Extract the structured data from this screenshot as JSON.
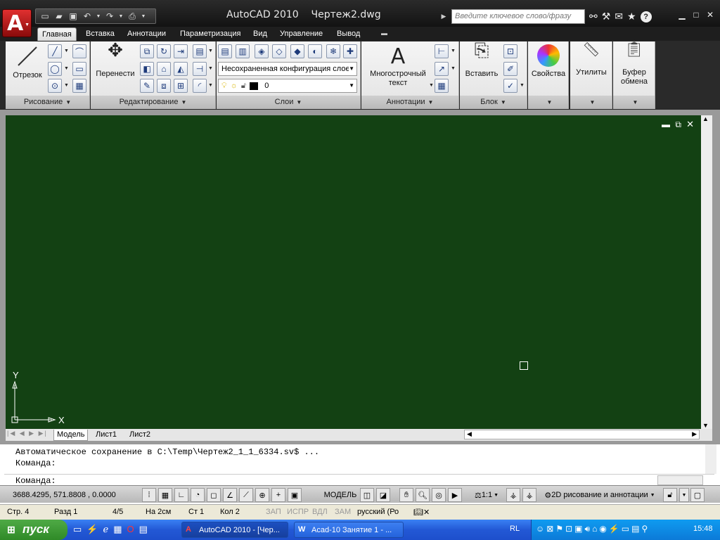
{
  "window": {
    "title": "AutoCAD 2010    Чертеж2.dwg",
    "search_placeholder": "Введите ключевое слово/фразу"
  },
  "ribbon_tabs": [
    "Главная",
    "Вставка",
    "Аннотации",
    "Параметризация",
    "Вид",
    "Управление",
    "Вывод"
  ],
  "panels": {
    "draw": {
      "title": "Рисование",
      "line_label": "Отрезок"
    },
    "modify": {
      "title": "Редактирование",
      "move_label": "Перенести"
    },
    "layers": {
      "title": "Слои",
      "layer_state": "Несохраненная конфигурация слоев",
      "current_layer": "0"
    },
    "annotation": {
      "title": "Аннотации",
      "mtext_line1": "Многострочный",
      "mtext_line2": "текст"
    },
    "block": {
      "title": "Блок",
      "insert_label": "Вставить"
    },
    "properties": {
      "label": "Свойства"
    },
    "utilities": {
      "label": "Утилиты"
    },
    "clipboard": {
      "line1": "Буфер",
      "line2": "обмена"
    }
  },
  "ucs": {
    "y": "Y",
    "x": "X"
  },
  "layout_tabs": [
    "Модель",
    "Лист1",
    "Лист2"
  ],
  "command": {
    "line1": "Автоматическое сохранение в C:\\Temp\\Чертеж2_1_1_6334.sv$ ...",
    "line2": "Команда:",
    "prompt": "Команда:"
  },
  "status": {
    "coords": "3688.4295, 571.8808 , 0.0000",
    "model": "МОДЕЛЬ",
    "scale": "1:1",
    "workspace": "2D рисование и аннотации"
  },
  "word_status": {
    "page": "Стр. 4",
    "section": "Разд 1",
    "pages": "4/5",
    "at": "На 2см",
    "line": "Ст 1",
    "col": "Кол 2",
    "rec": "ЗАП",
    "trk": "ИСПР",
    "ext": "ВДЛ",
    "ovr": "ЗАМ",
    "lang": "русский (Ро"
  },
  "taskbar": {
    "start": "пуск",
    "task1": "AutoCAD 2010 - [Чер...",
    "task2": "Acad-10 Занятие 1 - ...",
    "lang": "RL",
    "clock": "15:48"
  },
  "colors": {
    "canvas": "#134113",
    "accent": "#c81414",
    "taskbar": "#2358d5"
  }
}
